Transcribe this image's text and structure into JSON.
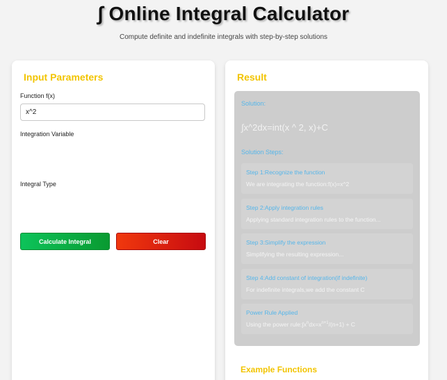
{
  "header": {
    "title": "∫ Online Integral Calculator",
    "subtitle": "Compute definite and indefinite integrals with step-by-step solutions"
  },
  "input_panel": {
    "heading": "Input Parameters",
    "function_label": "Function f(x)",
    "function_value": "x^2",
    "variable_label": "Integration Variable",
    "type_label": "Integral Type",
    "calculate_label": "Calculate Integral",
    "clear_label": "Clear"
  },
  "result_panel": {
    "heading": "Result",
    "solution_label": "Solution:",
    "solution_text": "∫x^2dx=int(x ^ 2, x)+C",
    "steps_label": "Solution Steps:",
    "steps": [
      {
        "title": "Step 1:Recognize the function",
        "text": "We are integrating the function:f(x)=x^2"
      },
      {
        "title": "Step 2:Apply integration rules",
        "text": "Applying standard integration rules to the function..."
      },
      {
        "title": "Step 3:Simplify the expression",
        "text": "Simplifying the resulting expression..."
      },
      {
        "title": "Step 4:Add constant of integration(if indefinite)",
        "text": "For indefinite integrals,we add the constant C"
      },
      {
        "title": "Power Rule Applied",
        "text_before": "Using the power rule:∫x",
        "text_sup1": "n",
        "text_mid": "dx=x",
        "text_sup2": "n+1",
        "text_after": "/(n+1) + C"
      }
    ],
    "examples_heading": "Example Functions"
  },
  "colors": {
    "accent_yellow": "#f2c400",
    "step_blue": "#56b6ea",
    "calc_green": "#0dc35a",
    "clear_red": "#e01e10",
    "result_gray": "#cdcdcd"
  }
}
